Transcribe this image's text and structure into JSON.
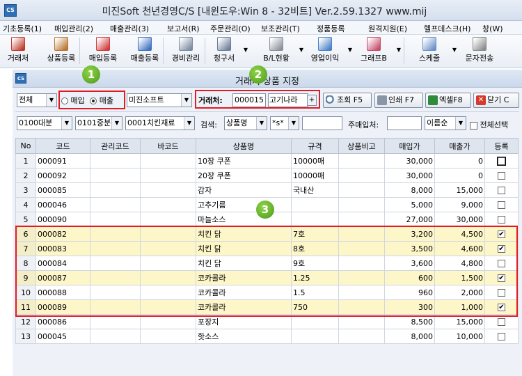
{
  "window": {
    "title": "미진Soft 천년경영C/S [내윈도우:Win 8 - 32비트] Ver.2.59.1327      www.mij",
    "icon": "CS"
  },
  "menu": [
    "기초등록(1)",
    "매입관리(2)",
    "매출관리(3)",
    "보고서(R)",
    "주문관리(O)",
    "보조관리(T)",
    "정품등록",
    "원격지원(E)",
    "헬프데스크(H)",
    "창(W)"
  ],
  "toolbar": [
    {
      "label": "거래처",
      "icon": "contact-card-icon",
      "color": "#c0392b"
    },
    {
      "label": "상품등록",
      "icon": "package-add-icon",
      "color": "#b8752f"
    },
    {
      "label": "매입등록",
      "icon": "purchase-icon",
      "color": "#d0393b"
    },
    {
      "label": "매출등록",
      "icon": "sales-icon",
      "color": "#3b6fc0"
    },
    {
      "label": "경비관리",
      "icon": "expense-icon",
      "color": "#7a8aa0"
    },
    {
      "label": "청구서",
      "icon": "invoice-icon",
      "color": "#6b7e99"
    },
    {
      "label": "B/L현황",
      "icon": "balance-icon",
      "color": "#8a8f99"
    },
    {
      "label": "영업이익",
      "icon": "profit-chart-icon",
      "color": "#4a7fc8"
    },
    {
      "label": "그래프B",
      "icon": "bar-graph-icon",
      "color": "#c84a6a"
    },
    {
      "label": "스케줄",
      "icon": "calendar-icon",
      "color": "#6a8fc8"
    },
    {
      "label": "문자전송",
      "icon": "phone-icon",
      "color": "#8a8a8a"
    }
  ],
  "dialog": {
    "title": "거래처 상품 지정",
    "icon": "CS",
    "filter_all": "전체",
    "radio_buy": "매입",
    "radio_sell": "매출",
    "radio_selected": "sell",
    "company_combo": "미진소프트",
    "client_label": "거래처:",
    "client_code": "000015",
    "client_name": "고기나라",
    "client_btn": "+",
    "btn_search": "조회 F5",
    "btn_print": "인쇄 F7",
    "btn_excel": "엑셀F8",
    "btn_close": "닫기 C",
    "cat_large": "0100대분",
    "cat_mid": "0101중분",
    "cat_small": "0001치킨재료",
    "search_label": "검색:",
    "search_field": "상품명",
    "search_mode": "*s*",
    "search_value": "",
    "main_client_label": "주매입처:",
    "main_client_value": "",
    "sort": "이름순",
    "select_all_label": "전체선택",
    "badges": [
      "1",
      "2",
      "3"
    ]
  },
  "grid": {
    "columns": [
      "No",
      "코드",
      "관리코드",
      "바코드",
      "상품명",
      "규격",
      "상품비고",
      "매입가",
      "매출가",
      "등록"
    ],
    "rows": [
      {
        "no": "1",
        "code": "000091",
        "mgmt": "",
        "barcode": "",
        "name": "10장 쿠폰",
        "spec": "10000매",
        "note": "",
        "buy": "30,000",
        "sell": "0",
        "reg": false,
        "hl": false
      },
      {
        "no": "2",
        "code": "000092",
        "mgmt": "",
        "barcode": "",
        "name": "20장 쿠폰",
        "spec": "10000매",
        "note": "",
        "buy": "30,000",
        "sell": "0",
        "reg": false,
        "hl": false
      },
      {
        "no": "3",
        "code": "000085",
        "mgmt": "",
        "barcode": "",
        "name": "감자",
        "spec": "국내산",
        "note": "",
        "buy": "8,000",
        "sell": "15,000",
        "reg": false,
        "hl": false
      },
      {
        "no": "4",
        "code": "000046",
        "mgmt": "",
        "barcode": "",
        "name": "고추기름",
        "spec": "",
        "note": "",
        "buy": "5,000",
        "sell": "9,000",
        "reg": false,
        "hl": false
      },
      {
        "no": "5",
        "code": "000090",
        "mgmt": "",
        "barcode": "",
        "name": "마늘소스",
        "spec": "",
        "note": "",
        "buy": "27,000",
        "sell": "30,000",
        "reg": false,
        "hl": false
      },
      {
        "no": "6",
        "code": "000082",
        "mgmt": "",
        "barcode": "",
        "name": "치킨 닭",
        "spec": "7호",
        "note": "",
        "buy": "3,200",
        "sell": "4,500",
        "reg": true,
        "hl": true
      },
      {
        "no": "7",
        "code": "000083",
        "mgmt": "",
        "barcode": "",
        "name": "치킨 닭",
        "spec": "8호",
        "note": "",
        "buy": "3,500",
        "sell": "4,600",
        "reg": true,
        "hl": true
      },
      {
        "no": "8",
        "code": "000084",
        "mgmt": "",
        "barcode": "",
        "name": "치킨 닭",
        "spec": "9호",
        "note": "",
        "buy": "3,600",
        "sell": "4,800",
        "reg": false,
        "hl": false
      },
      {
        "no": "9",
        "code": "000087",
        "mgmt": "",
        "barcode": "",
        "name": "코카콜라",
        "spec": "1.25",
        "note": "",
        "buy": "600",
        "sell": "1,500",
        "reg": true,
        "hl": true
      },
      {
        "no": "10",
        "code": "000088",
        "mgmt": "",
        "barcode": "",
        "name": "코카콜라",
        "spec": "1.5",
        "note": "",
        "buy": "960",
        "sell": "2,000",
        "reg": false,
        "hl": false
      },
      {
        "no": "11",
        "code": "000089",
        "mgmt": "",
        "barcode": "",
        "name": "코카콜라",
        "spec": "750",
        "note": "",
        "buy": "300",
        "sell": "1,000",
        "reg": true,
        "hl": true
      },
      {
        "no": "12",
        "code": "000086",
        "mgmt": "",
        "barcode": "",
        "name": "포장지",
        "spec": "",
        "note": "",
        "buy": "8,500",
        "sell": "15,000",
        "reg": false,
        "hl": false
      },
      {
        "no": "13",
        "code": "000045",
        "mgmt": "",
        "barcode": "",
        "name": "핫소스",
        "spec": "",
        "note": "",
        "buy": "8,000",
        "sell": "10,000",
        "reg": false,
        "hl": false
      }
    ]
  }
}
